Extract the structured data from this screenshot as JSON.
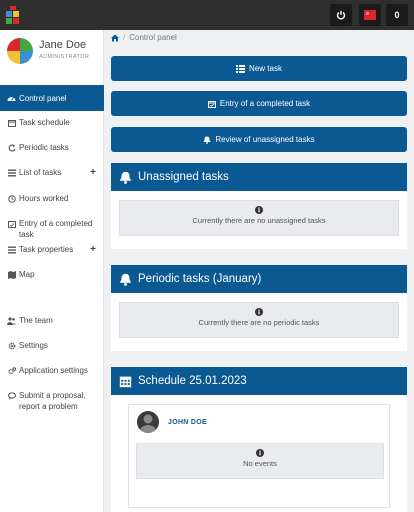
{
  "topbar": {
    "notification_count": "0",
    "colors": {
      "bar": "#2f2f2f",
      "flag": "#d9272e"
    }
  },
  "profile": {
    "name": "Jane Doe",
    "role": "ADMINISTRATOR"
  },
  "sidebar": {
    "items": [
      {
        "label": "Control panel",
        "icon": "dashboard-icon"
      },
      {
        "label": "Task schedule",
        "icon": "calendar-icon"
      },
      {
        "label": "Periodic tasks",
        "icon": "refresh-icon"
      },
      {
        "label": "List of tasks",
        "icon": "list-icon",
        "expandable": "+"
      },
      {
        "label": "Hours worked",
        "icon": "clock-icon"
      },
      {
        "label": "Entry of a completed task",
        "icon": "calendar-check-icon"
      },
      {
        "label": "Task properties",
        "icon": "list-icon",
        "expandable": "+"
      },
      {
        "label": "Map",
        "icon": "map-icon"
      },
      {
        "label": "The team",
        "icon": "team-icon"
      },
      {
        "label": "Settings",
        "icon": "gear-icon"
      },
      {
        "label": "Application settings",
        "icon": "gears-icon"
      },
      {
        "label": "Submit a proposal, report a problem",
        "icon": "comment-icon"
      }
    ]
  },
  "breadcrumb": {
    "current": "Control panel"
  },
  "actions": {
    "new_task": "New task",
    "entry_completed": "Entry of a completed task",
    "review_unassigned": "Review of unassigned tasks"
  },
  "panels": {
    "unassigned": {
      "title": "Unassigned tasks",
      "empty": "Currently there are no unassigned tasks"
    },
    "periodic": {
      "title": "Periodic tasks (January)",
      "empty": "Currently there are no periodic tasks"
    },
    "schedule": {
      "title": "Schedule 25.01.2023",
      "person": "JOHN DOE",
      "empty": "No events"
    }
  },
  "colors": {
    "primary": "#0b5993",
    "active_nav": "#0b5993"
  }
}
